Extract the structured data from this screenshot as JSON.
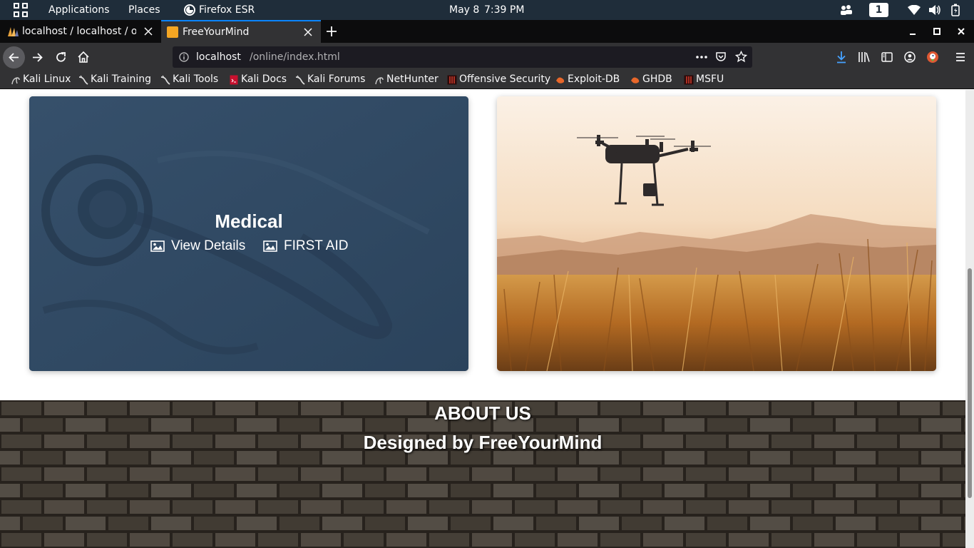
{
  "panel": {
    "activities_icon": "grid-icon",
    "applications": "Applications",
    "places": "Places",
    "app_name": "Firefox ESR",
    "date": "May 8",
    "time": "7:39 PM",
    "workspace": "1"
  },
  "tabs": [
    {
      "title": "localhost / localhost / onli",
      "icon": "phpmyadmin-icon"
    },
    {
      "title": "FreeYourMind",
      "icon": "square-favicon-icon",
      "favicon_color": "#f5a623"
    }
  ],
  "url": {
    "host": "localhost",
    "path": "/online/index.html"
  },
  "bookmarks": [
    {
      "label": "Kali Linux"
    },
    {
      "label": "Kali Training"
    },
    {
      "label": "Kali Tools"
    },
    {
      "label": "Kali Docs"
    },
    {
      "label": "Kali Forums"
    },
    {
      "label": "NetHunter"
    },
    {
      "label": "Offensive Security"
    },
    {
      "label": "Exploit-DB"
    },
    {
      "label": "GHDB"
    },
    {
      "label": "MSFU"
    }
  ],
  "content": {
    "card": {
      "title": "Medical",
      "link1": "View Details",
      "link2": "FIRST AID"
    },
    "footer": {
      "title": "ABOUT US",
      "subtitle": "Designed by FreeYourMind"
    }
  },
  "colors": {
    "panel_bg": "#1f2d3a",
    "tab_accent": "#0a84ff",
    "card_overlay": "#2c445d",
    "download_icon": "#45a1ff"
  }
}
